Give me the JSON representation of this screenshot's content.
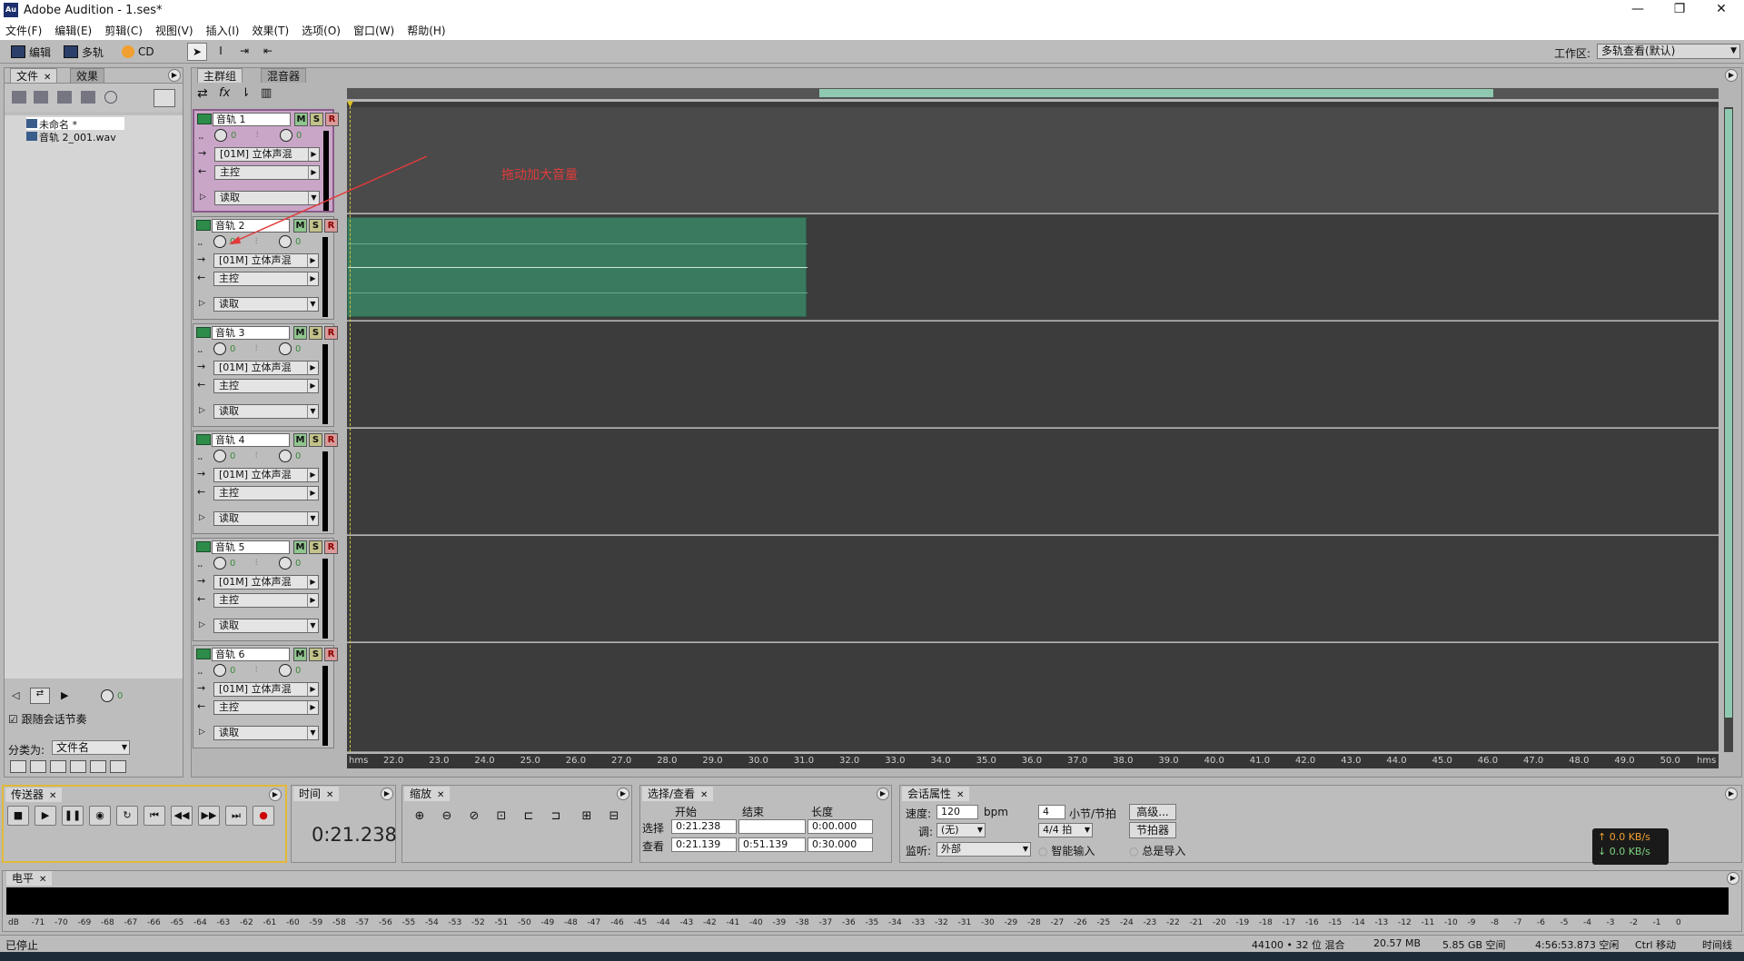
{
  "window": {
    "title": "Adobe Audition - 1.ses*",
    "logo": "Au",
    "minimize": "—",
    "maximize": "❐",
    "close": "✕"
  },
  "menu": [
    "文件(F)",
    "编辑(E)",
    "剪辑(C)",
    "视图(V)",
    "插入(I)",
    "效果(T)",
    "选项(O)",
    "窗口(W)",
    "帮助(H)"
  ],
  "toolbar": {
    "edit": "编辑",
    "multitrack": "多轨",
    "cd": "CD",
    "workspace_label": "工作区:",
    "workspace_value": "多轨查看(默认)"
  },
  "files_panel": {
    "tabs": [
      "文件",
      "效果"
    ],
    "items": [
      "未命名 *",
      "音轨 2_001.wav"
    ],
    "follow_label": "跟随会话节奏",
    "sort_label": "分类为:",
    "sort_value": "文件名",
    "vol_value": "0"
  },
  "main": {
    "tabs": [
      "主群组",
      "混音器"
    ],
    "annotation": "拖动加大音量",
    "tracks": [
      {
        "name": "音轨 1",
        "vol": "0",
        "pan": "0",
        "input": "[01M] 立体声混",
        "output": "主控",
        "auto": "读取",
        "selected": true
      },
      {
        "name": "音轨 2",
        "vol": "0",
        "pan": "0",
        "input": "[01M] 立体声混",
        "output": "主控",
        "auto": "读取",
        "selected": false
      },
      {
        "name": "音轨 3",
        "vol": "0",
        "pan": "0",
        "input": "[01M] 立体声混",
        "output": "主控",
        "auto": "读取",
        "selected": false
      },
      {
        "name": "音轨 4",
        "vol": "0",
        "pan": "0",
        "input": "[01M] 立体声混",
        "output": "主控",
        "auto": "读取",
        "selected": false
      },
      {
        "name": "音轨 5",
        "vol": "0",
        "pan": "0",
        "input": "[01M] 立体声混",
        "output": "主控",
        "auto": "读取",
        "selected": false
      },
      {
        "name": "音轨 6",
        "vol": "0",
        "pan": "0",
        "input": "[01M] 立体声混",
        "output": "主控",
        "auto": "读取",
        "selected": false
      }
    ],
    "btn_m": "M",
    "btn_s": "S",
    "btn_r": "R",
    "ruler": [
      "hms",
      "22.0",
      "23.0",
      "24.0",
      "25.0",
      "26.0",
      "27.0",
      "28.0",
      "29.0",
      "30.0",
      "31.0",
      "32.0",
      "33.0",
      "34.0",
      "35.0",
      "36.0",
      "37.0",
      "38.0",
      "39.0",
      "40.0",
      "41.0",
      "42.0",
      "43.0",
      "44.0",
      "45.0",
      "46.0",
      "47.0",
      "48.0",
      "49.0",
      "50.0",
      "hms"
    ]
  },
  "transport": {
    "tab": "传送器"
  },
  "time": {
    "tab": "时间",
    "value": "0:21.238"
  },
  "zoom": {
    "tab": "缩放"
  },
  "selection": {
    "tab": "选择/查看",
    "col_start": "开始",
    "col_end": "结束",
    "col_length": "长度",
    "row_sel": "选择",
    "row_view": "查看",
    "sel_start": "0:21.238",
    "sel_end": "",
    "sel_length": "0:00.000",
    "view_start": "0:21.139",
    "view_end": "0:51.139",
    "view_length": "0:30.000"
  },
  "session": {
    "tab": "会话属性",
    "tempo_label": "速度:",
    "tempo_value": "120",
    "bpm": "bpm",
    "beats_value": "4",
    "beats_label": "小节/节拍",
    "advanced": "高级...",
    "key_label": "调:",
    "key_value": "(无)",
    "time_sig": "4/4 拍",
    "metronome": "节拍器",
    "monitor_label": "监听:",
    "monitor_value": "外部",
    "smart_input": "智能输入",
    "always_input": "总是导入"
  },
  "net": {
    "up": "↑ 0.0 KB/s",
    "down": "↓ 0.0 KB/s"
  },
  "levels": {
    "tab": "电平",
    "scale": [
      "dB",
      "-71",
      "-70",
      "-69",
      "-68",
      "-67",
      "-66",
      "-65",
      "-64",
      "-63",
      "-62",
      "-61",
      "-60",
      "-59",
      "-58",
      "-57",
      "-56",
      "-55",
      "-54",
      "-53",
      "-52",
      "-51",
      "-50",
      "-49",
      "-48",
      "-47",
      "-46",
      "-45",
      "-44",
      "-43",
      "-42",
      "-41",
      "-40",
      "-39",
      "-38",
      "-37",
      "-36",
      "-35",
      "-34",
      "-33",
      "-32",
      "-31",
      "-30",
      "-29",
      "-28",
      "-27",
      "-26",
      "-25",
      "-24",
      "-23",
      "-22",
      "-21",
      "-20",
      "-19",
      "-18",
      "-17",
      "-16",
      "-15",
      "-14",
      "-13",
      "-12",
      "-11",
      "-10",
      "-9",
      "-8",
      "-7",
      "-6",
      "-5",
      "-4",
      "-3",
      "-2",
      "-1",
      "0"
    ]
  },
  "status": {
    "left": "已停止",
    "format": "44100 • 32 位 混合",
    "size": "20.57 MB",
    "free": "5.85 GB 空间",
    "time_free": "4:56:53.873 空闲",
    "hint": "Ctrl 移动",
    "mode": "时间线"
  },
  "colors": {
    "accent": "#3a7a5e",
    "annotation": "#e23b3b",
    "selected_track": "#c9a6c7"
  }
}
